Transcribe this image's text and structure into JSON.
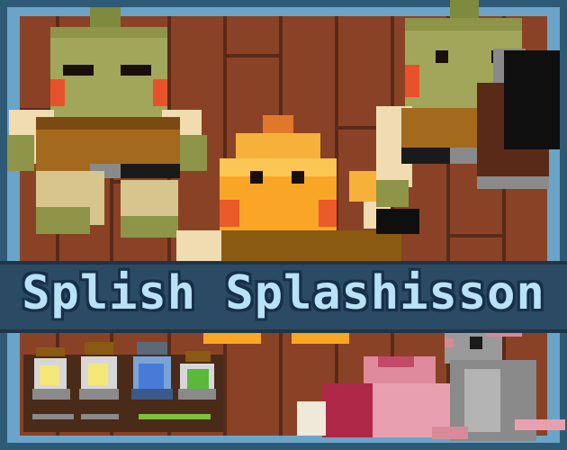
{
  "game": {
    "title": "Splish Splashisson"
  },
  "colors": {
    "frame": "#6aa4c8",
    "frame_dark": "#2f5a75",
    "wood": "#8a4226",
    "wood_dark": "#5a2a18",
    "title_band": "#2b4a63",
    "title_text": "#b9e2f7",
    "potion_green_bar": "#7fbf3a"
  },
  "inventory": {
    "potions": [
      {
        "icon": "potion-yellow-icon",
        "filled": false
      },
      {
        "icon": "potion-yellow-icon",
        "filled": false
      },
      {
        "icon": "potion-blue-icon",
        "filled": true
      },
      {
        "icon": "potion-green-icon",
        "filled": true
      }
    ]
  },
  "characters": [
    {
      "icon": "frog-warrior-icon"
    },
    {
      "icon": "fire-spirit-icon"
    },
    {
      "icon": "frog-hammer-icon"
    },
    {
      "icon": "rat-icon"
    },
    {
      "icon": "meat-icon"
    }
  ]
}
